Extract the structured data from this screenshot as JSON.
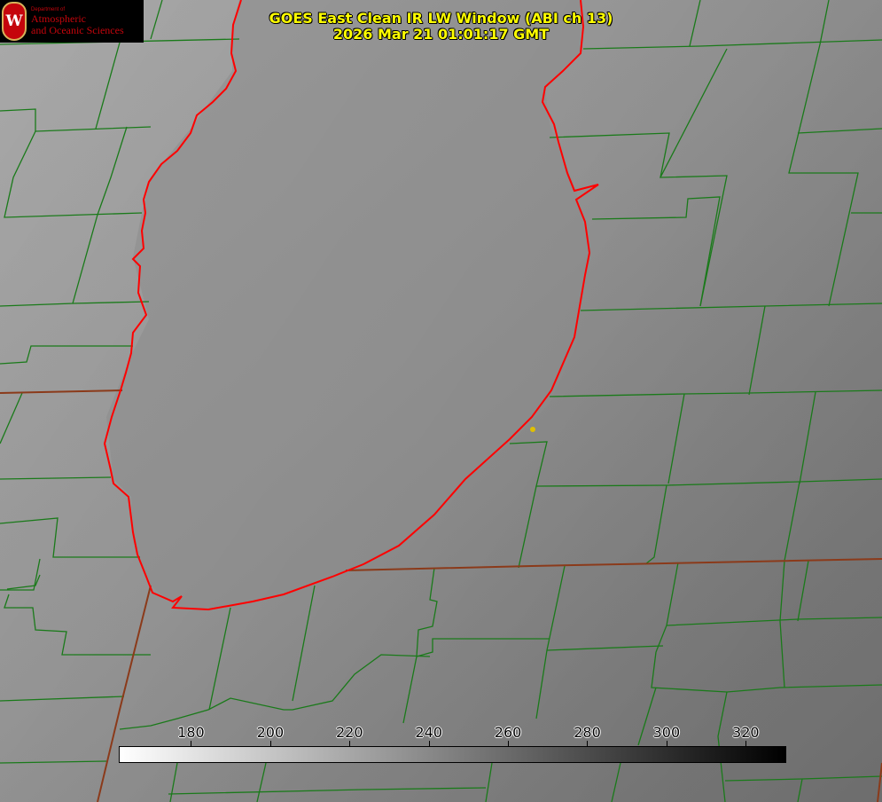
{
  "header": {
    "title_line1": "GOES East Clean IR LW Window (ABI ch 13)",
    "title_line2": "2026 Mar 21 01:01:17 GMT"
  },
  "logo": {
    "crest_letter": "W",
    "department": "Department of",
    "line1": "Atmospheric",
    "line2": "and Oceanic Sciences"
  },
  "colorbar": {
    "min": 162,
    "max": 330,
    "ticks": [
      {
        "value": 180,
        "label": "180"
      },
      {
        "value": 200,
        "label": "200"
      },
      {
        "value": 220,
        "label": "220"
      },
      {
        "value": 240,
        "label": "240"
      },
      {
        "value": 260,
        "label": "260"
      },
      {
        "value": 280,
        "label": "280"
      },
      {
        "value": 300,
        "label": "300"
      },
      {
        "value": 320,
        "label": "320"
      }
    ]
  },
  "colors": {
    "title_text": "#ffff00",
    "county_lines": "#1a7a1a",
    "coast_line": "#ff0000",
    "state_line": "#8b3a1a",
    "marker": "#e0c000"
  }
}
